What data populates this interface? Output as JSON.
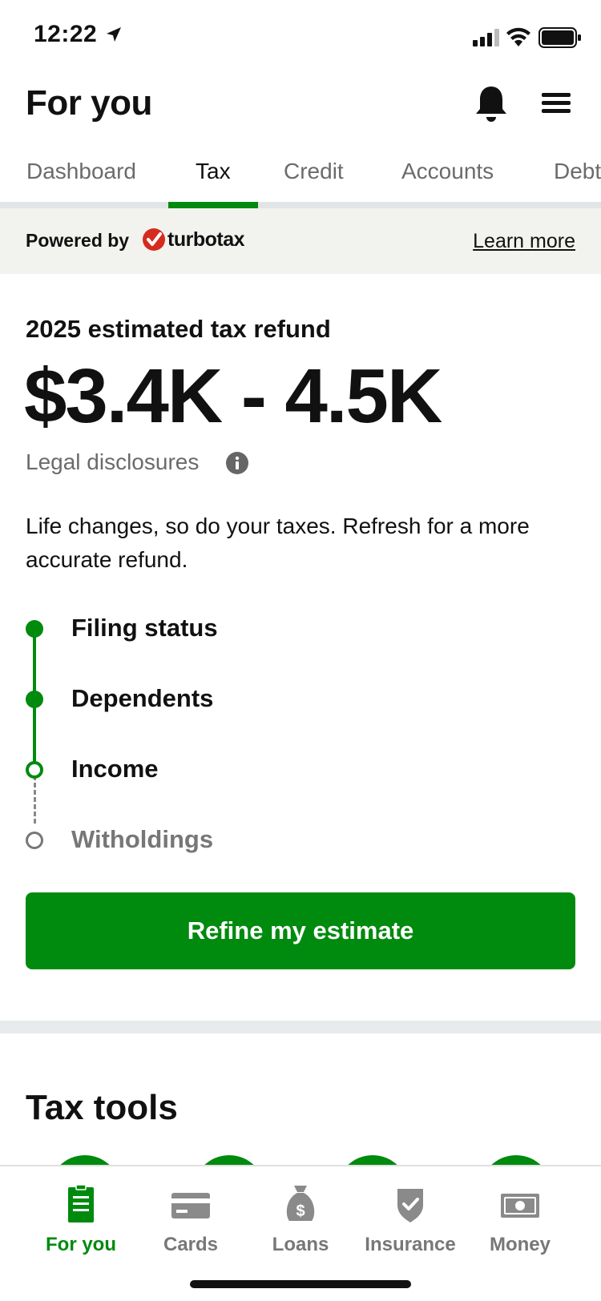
{
  "status_bar": {
    "time": "12:22"
  },
  "header": {
    "title": "For you"
  },
  "tabs": [
    {
      "label": "Dashboard"
    },
    {
      "label": "Tax"
    },
    {
      "label": "Credit"
    },
    {
      "label": "Accounts"
    },
    {
      "label": "Debt"
    }
  ],
  "active_tab": "Tax",
  "powered": {
    "prefix": "Powered by",
    "brand": "turbotax",
    "learn_more": "Learn more"
  },
  "estimate": {
    "label": "2025 estimated tax refund",
    "value": "$3.4K - 4.5K",
    "disclosures": "Legal disclosures",
    "description": "Life changes, so do your taxes. Refresh for a more accurate refund."
  },
  "steps": [
    {
      "label": "Filing status",
      "state": "done"
    },
    {
      "label": "Dependents",
      "state": "done"
    },
    {
      "label": "Income",
      "state": "current"
    },
    {
      "label": "Witholdings",
      "state": "todo"
    }
  ],
  "refine_button": "Refine my estimate",
  "tools": {
    "title": "Tax tools"
  },
  "bottom_nav": [
    {
      "label": "For you",
      "icon": "document-icon",
      "active": true
    },
    {
      "label": "Cards",
      "icon": "card-icon",
      "active": false
    },
    {
      "label": "Loans",
      "icon": "money-bag-icon",
      "active": false
    },
    {
      "label": "Insurance",
      "icon": "shield-icon",
      "active": false
    },
    {
      "label": "Money",
      "icon": "cash-icon",
      "active": false
    }
  ],
  "colors": {
    "accent": "#008a0e",
    "muted": "#6b6b6b",
    "banner_bg": "#f2f2ef"
  }
}
